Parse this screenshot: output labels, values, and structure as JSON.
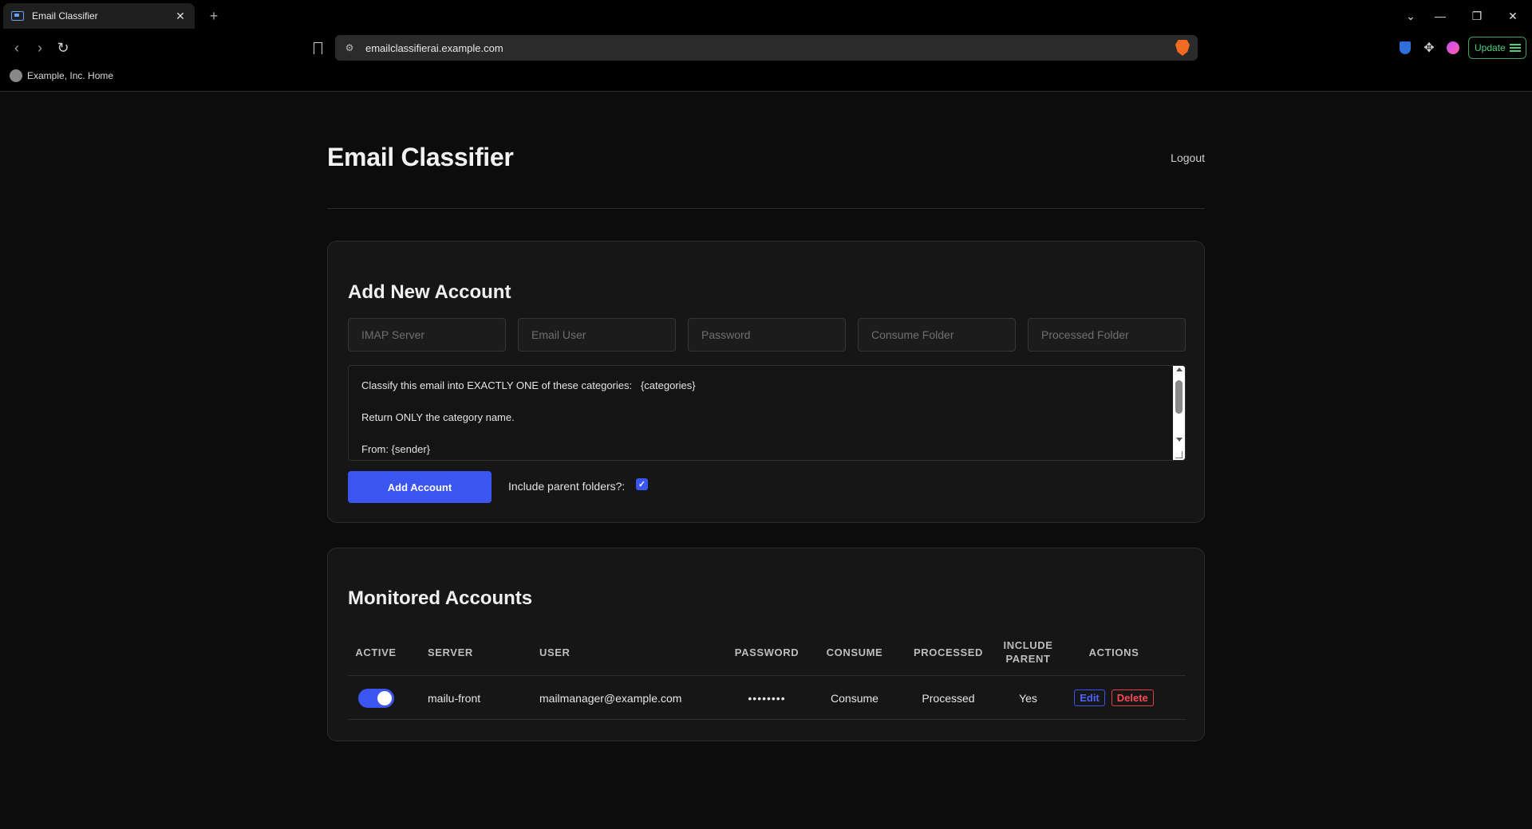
{
  "browser": {
    "tab_title": "Email Classifier",
    "tab_close": "✕",
    "new_tab": "+",
    "url": "emailclassifierai.example.com",
    "bookmark_label": "Example, Inc. Home",
    "update_label": "Update",
    "window_controls": {
      "tabs_menu": "⌄",
      "minimize": "—",
      "restore": "❐",
      "close": "✕"
    },
    "nav": {
      "back": "‹",
      "forward": "›",
      "reload": "↻"
    }
  },
  "header": {
    "title": "Email Classifier",
    "logout": "Logout"
  },
  "add_account": {
    "heading": "Add New Account",
    "fields": {
      "imap_server": "IMAP Server",
      "email_user": "Email User",
      "password": "Password",
      "consume_folder": "Consume Folder",
      "processed_folder": "Processed Folder"
    },
    "prompt_lines": [
      "Classify this email into EXACTLY ONE of these categories:   {categories}",
      "Return ONLY the category name.",
      "From: {sender}"
    ],
    "submit_label": "Add Account",
    "include_parent_label": "Include parent folders?:",
    "include_parent_checked": true
  },
  "monitored": {
    "heading": "Monitored Accounts",
    "columns": {
      "active": "ACTIVE",
      "server": "SERVER",
      "user": "USER",
      "password": "PASSWORD",
      "consume": "CONSUME",
      "processed": "PROCESSED",
      "include_parent": "INCLUDE PARENT",
      "actions": "ACTIONS"
    },
    "rows": [
      {
        "active": true,
        "server": "mailu-front",
        "user": "mailmanager@example.com",
        "password": "••••••••",
        "consume": "Consume",
        "processed": "Processed",
        "include_parent": "Yes",
        "edit_label": "Edit",
        "delete_label": "Delete"
      }
    ]
  },
  "colors": {
    "accent": "#3a55f0",
    "danger": "#e5404b",
    "background": "#0c0c0c",
    "card": "#161616"
  }
}
